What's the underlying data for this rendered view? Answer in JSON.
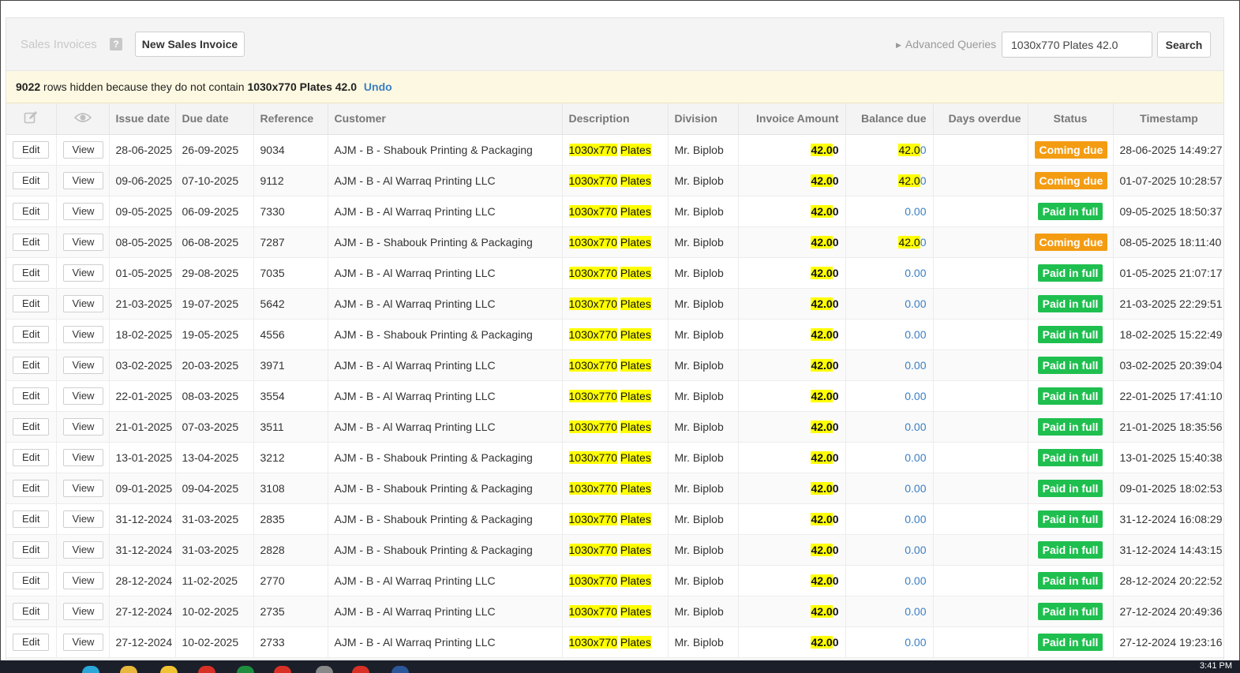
{
  "header": {
    "title": "Sales Invoices",
    "help_glyph": "?",
    "new_button": "New Sales Invoice",
    "advanced_queries": "Advanced Queries",
    "search_value": "1030x770 Plates 42.0",
    "search_button": "Search"
  },
  "notice": {
    "hidden_count": "9022",
    "text": "rows hidden because they do not contain",
    "query": "1030x770 Plates 42.0",
    "undo": "Undo"
  },
  "columns": {
    "edit_icon": "pencil-square-icon",
    "view_icon": "eye-icon",
    "issue_date": "Issue date",
    "due_date": "Due date",
    "reference": "Reference",
    "customer": "Customer",
    "description": "Description",
    "division": "Division",
    "invoice_amount": "Invoice Amount",
    "balance_due": "Balance due",
    "days_overdue": "Days overdue",
    "status": "Status",
    "timestamp": "Timestamp"
  },
  "labels": {
    "edit": "Edit",
    "view": "View",
    "desc_size": "1030x770",
    "desc_item": "Plates",
    "amount_hl": "42.0",
    "amount_tail": "0"
  },
  "colors": {
    "coming_due": "#f39c12",
    "paid_in_full": "#1fbf4f",
    "highlight": "#ffff00",
    "link": "#3a7fc4"
  },
  "rows": [
    {
      "issue_date": "28-06-2025",
      "due_date": "26-09-2025",
      "reference": "9034",
      "customer": "AJM - B - Shabouk Printing & Packaging",
      "division": "Mr. Biplob",
      "balance": "42.00",
      "status": "Coming due",
      "timestamp": "28-06-2025 14:49:27"
    },
    {
      "issue_date": "09-06-2025",
      "due_date": "07-10-2025",
      "reference": "9112",
      "customer": "AJM - B - Al Warraq Printing LLC",
      "division": "Mr. Biplob",
      "balance": "42.00",
      "status": "Coming due",
      "timestamp": "01-07-2025 10:28:57"
    },
    {
      "issue_date": "09-05-2025",
      "due_date": "06-09-2025",
      "reference": "7330",
      "customer": "AJM - B - Al Warraq Printing LLC",
      "division": "Mr. Biplob",
      "balance": "0.00",
      "status": "Paid in full",
      "timestamp": "09-05-2025 18:50:37"
    },
    {
      "issue_date": "08-05-2025",
      "due_date": "06-08-2025",
      "reference": "7287",
      "customer": "AJM - B - Shabouk Printing & Packaging",
      "division": "Mr. Biplob",
      "balance": "42.00",
      "status": "Coming due",
      "timestamp": "08-05-2025 18:11:40"
    },
    {
      "issue_date": "01-05-2025",
      "due_date": "29-08-2025",
      "reference": "7035",
      "customer": "AJM - B - Al Warraq Printing LLC",
      "division": "Mr. Biplob",
      "balance": "0.00",
      "status": "Paid in full",
      "timestamp": "01-05-2025 21:07:17"
    },
    {
      "issue_date": "21-03-2025",
      "due_date": "19-07-2025",
      "reference": "5642",
      "customer": "AJM - B - Al Warraq Printing LLC",
      "division": "Mr. Biplob",
      "balance": "0.00",
      "status": "Paid in full",
      "timestamp": "21-03-2025 22:29:51"
    },
    {
      "issue_date": "18-02-2025",
      "due_date": "19-05-2025",
      "reference": "4556",
      "customer": "AJM - B - Shabouk Printing & Packaging",
      "division": "Mr. Biplob",
      "balance": "0.00",
      "status": "Paid in full",
      "timestamp": "18-02-2025 15:22:49"
    },
    {
      "issue_date": "03-02-2025",
      "due_date": "20-03-2025",
      "reference": "3971",
      "customer": "AJM - B - Al Warraq Printing LLC",
      "division": "Mr. Biplob",
      "balance": "0.00",
      "status": "Paid in full",
      "timestamp": "03-02-2025 20:39:04"
    },
    {
      "issue_date": "22-01-2025",
      "due_date": "08-03-2025",
      "reference": "3554",
      "customer": "AJM - B - Al Warraq Printing LLC",
      "division": "Mr. Biplob",
      "balance": "0.00",
      "status": "Paid in full",
      "timestamp": "22-01-2025 17:41:10"
    },
    {
      "issue_date": "21-01-2025",
      "due_date": "07-03-2025",
      "reference": "3511",
      "customer": "AJM - B - Al Warraq Printing LLC",
      "division": "Mr. Biplob",
      "balance": "0.00",
      "status": "Paid in full",
      "timestamp": "21-01-2025 18:35:56"
    },
    {
      "issue_date": "13-01-2025",
      "due_date": "13-04-2025",
      "reference": "3212",
      "customer": "AJM - B - Shabouk Printing & Packaging",
      "division": "Mr. Biplob",
      "balance": "0.00",
      "status": "Paid in full",
      "timestamp": "13-01-2025 15:40:38"
    },
    {
      "issue_date": "09-01-2025",
      "due_date": "09-04-2025",
      "reference": "3108",
      "customer": "AJM - B - Shabouk Printing & Packaging",
      "division": "Mr. Biplob",
      "balance": "0.00",
      "status": "Paid in full",
      "timestamp": "09-01-2025 18:02:53"
    },
    {
      "issue_date": "31-12-2024",
      "due_date": "31-03-2025",
      "reference": "2835",
      "customer": "AJM - B - Shabouk Printing & Packaging",
      "division": "Mr. Biplob",
      "balance": "0.00",
      "status": "Paid in full",
      "timestamp": "31-12-2024 16:08:29"
    },
    {
      "issue_date": "31-12-2024",
      "due_date": "31-03-2025",
      "reference": "2828",
      "customer": "AJM - B - Shabouk Printing & Packaging",
      "division": "Mr. Biplob",
      "balance": "0.00",
      "status": "Paid in full",
      "timestamp": "31-12-2024 14:43:15"
    },
    {
      "issue_date": "28-12-2024",
      "due_date": "11-02-2025",
      "reference": "2770",
      "customer": "AJM - B - Al Warraq Printing LLC",
      "division": "Mr. Biplob",
      "balance": "0.00",
      "status": "Paid in full",
      "timestamp": "28-12-2024 20:22:52"
    },
    {
      "issue_date": "27-12-2024",
      "due_date": "10-02-2025",
      "reference": "2735",
      "customer": "AJM - B - Al Warraq Printing LLC",
      "division": "Mr. Biplob",
      "balance": "0.00",
      "status": "Paid in full",
      "timestamp": "27-12-2024 20:49:36"
    },
    {
      "issue_date": "27-12-2024",
      "due_date": "10-02-2025",
      "reference": "2733",
      "customer": "AJM - B - Al Warraq Printing LLC",
      "division": "Mr. Biplob",
      "balance": "0.00",
      "status": "Paid in full",
      "timestamp": "27-12-2024 19:23:16"
    }
  ],
  "taskbar": {
    "clock": "3:41 PM"
  }
}
